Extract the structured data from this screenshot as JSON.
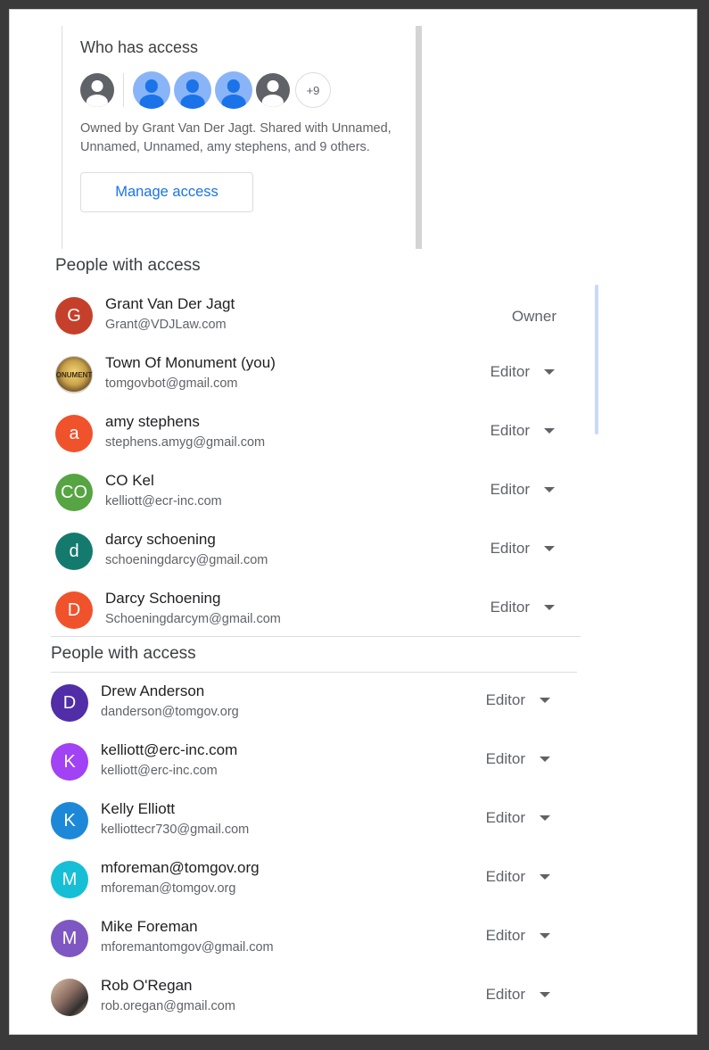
{
  "who_has_access": {
    "title": "Who has access",
    "more_count": "+9",
    "description": "Owned by Grant Van Der Jagt. Shared with Unnamed, Unnamed, Unnamed, amy stephens, and 9 others.",
    "manage_label": "Manage access"
  },
  "section1": {
    "title": "People with access",
    "people": [
      {
        "initial": "G",
        "name": "Grant Van Der Jagt",
        "email": "Grant@VDJLaw.com",
        "role": "Owner",
        "color": "#c5402b"
      },
      {
        "initial": "ONUMENT",
        "name": "Town Of Monument (you)",
        "email": "tomgovbot@gmail.com",
        "role": "Editor",
        "color": "#c8a24a"
      },
      {
        "initial": "a",
        "name": "amy stephens",
        "email": "stephens.amyg@gmail.com",
        "role": "Editor",
        "color": "#f0522c"
      },
      {
        "initial": "CO",
        "name": "CO Kel",
        "email": "kelliott@ecr-inc.com",
        "role": "Editor",
        "color": "#56a442"
      },
      {
        "initial": "d",
        "name": "darcy schoening",
        "email": "schoeningdarcy@gmail.com",
        "role": "Editor",
        "color": "#147a6e"
      },
      {
        "initial": "D",
        "name": "Darcy Schoening",
        "email": "Schoeningdarcym@gmail.com",
        "role": "Editor",
        "color": "#f0522c"
      }
    ]
  },
  "section2": {
    "title": "People with access",
    "people": [
      {
        "initial": "D",
        "name": "Drew Anderson",
        "email": "danderson@tomgov.org",
        "role": "Editor",
        "color": "#512da8"
      },
      {
        "initial": "K",
        "name": "kelliott@erc-inc.com",
        "email": "kelliott@erc-inc.com",
        "role": "Editor",
        "color": "#a142f4"
      },
      {
        "initial": "K",
        "name": "Kelly Elliott",
        "email": "kelliottecr730@gmail.com",
        "role": "Editor",
        "color": "#1e88d8"
      },
      {
        "initial": "M",
        "name": "mforeman@tomgov.org",
        "email": "mforeman@tomgov.org",
        "role": "Editor",
        "color": "#17bfd6"
      },
      {
        "initial": "M",
        "name": "Mike Foreman",
        "email": "mforemantomgov@gmail.com",
        "role": "Editor",
        "color": "#7e57c2"
      },
      {
        "initial": "",
        "name": "Rob O'Regan",
        "email": "rob.oregan@gmail.com",
        "role": "Editor",
        "color": "#8d6e63"
      }
    ]
  }
}
